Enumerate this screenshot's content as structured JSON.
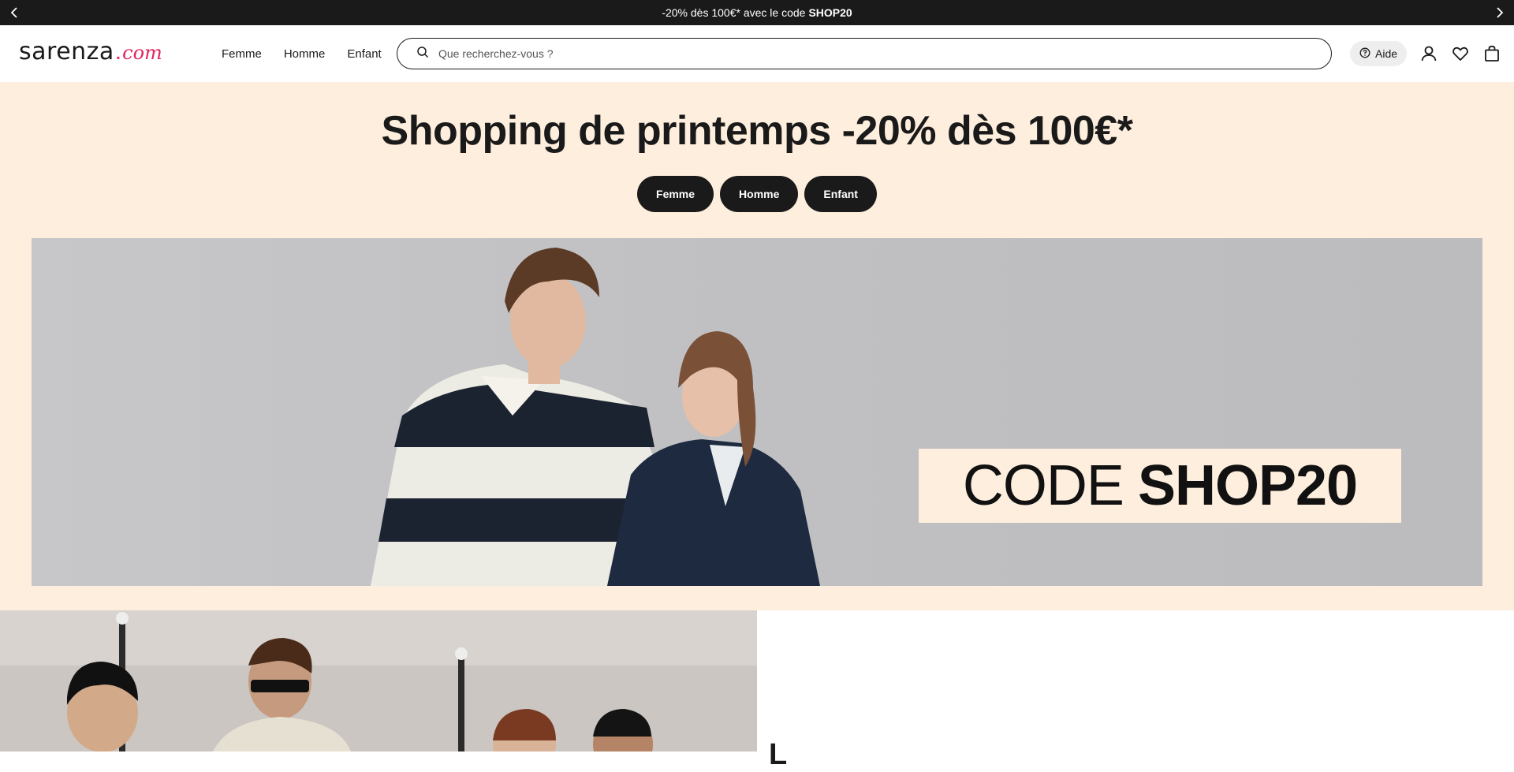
{
  "promo_bar": {
    "text": "-20% dès 100€* avec le code",
    "code": "SHOP20",
    "prev_icon": "chevron-left-icon",
    "next_icon": "chevron-right-icon"
  },
  "header": {
    "logo_word": "sarenza",
    "logo_dot": ".",
    "logo_com": "com",
    "nav": [
      "Femme",
      "Homme",
      "Enfant"
    ],
    "search_placeholder": "Que recherchez-vous ?",
    "help_label": "Aide",
    "icons": [
      "help-circle-icon",
      "user-icon",
      "heart-icon",
      "shopping-bag-icon"
    ]
  },
  "hero": {
    "title": "Shopping de printemps -20% dès 100€*",
    "buttons": [
      "Femme",
      "Homme",
      "Enfant"
    ],
    "banner_code_light": "CODE",
    "banner_code_bold": "SHOP20"
  },
  "lower": {
    "title": "L"
  },
  "colors": {
    "dark": "#1a1a1a",
    "hero_bg": "#feeedd",
    "brand_pink": "#e0245e"
  }
}
